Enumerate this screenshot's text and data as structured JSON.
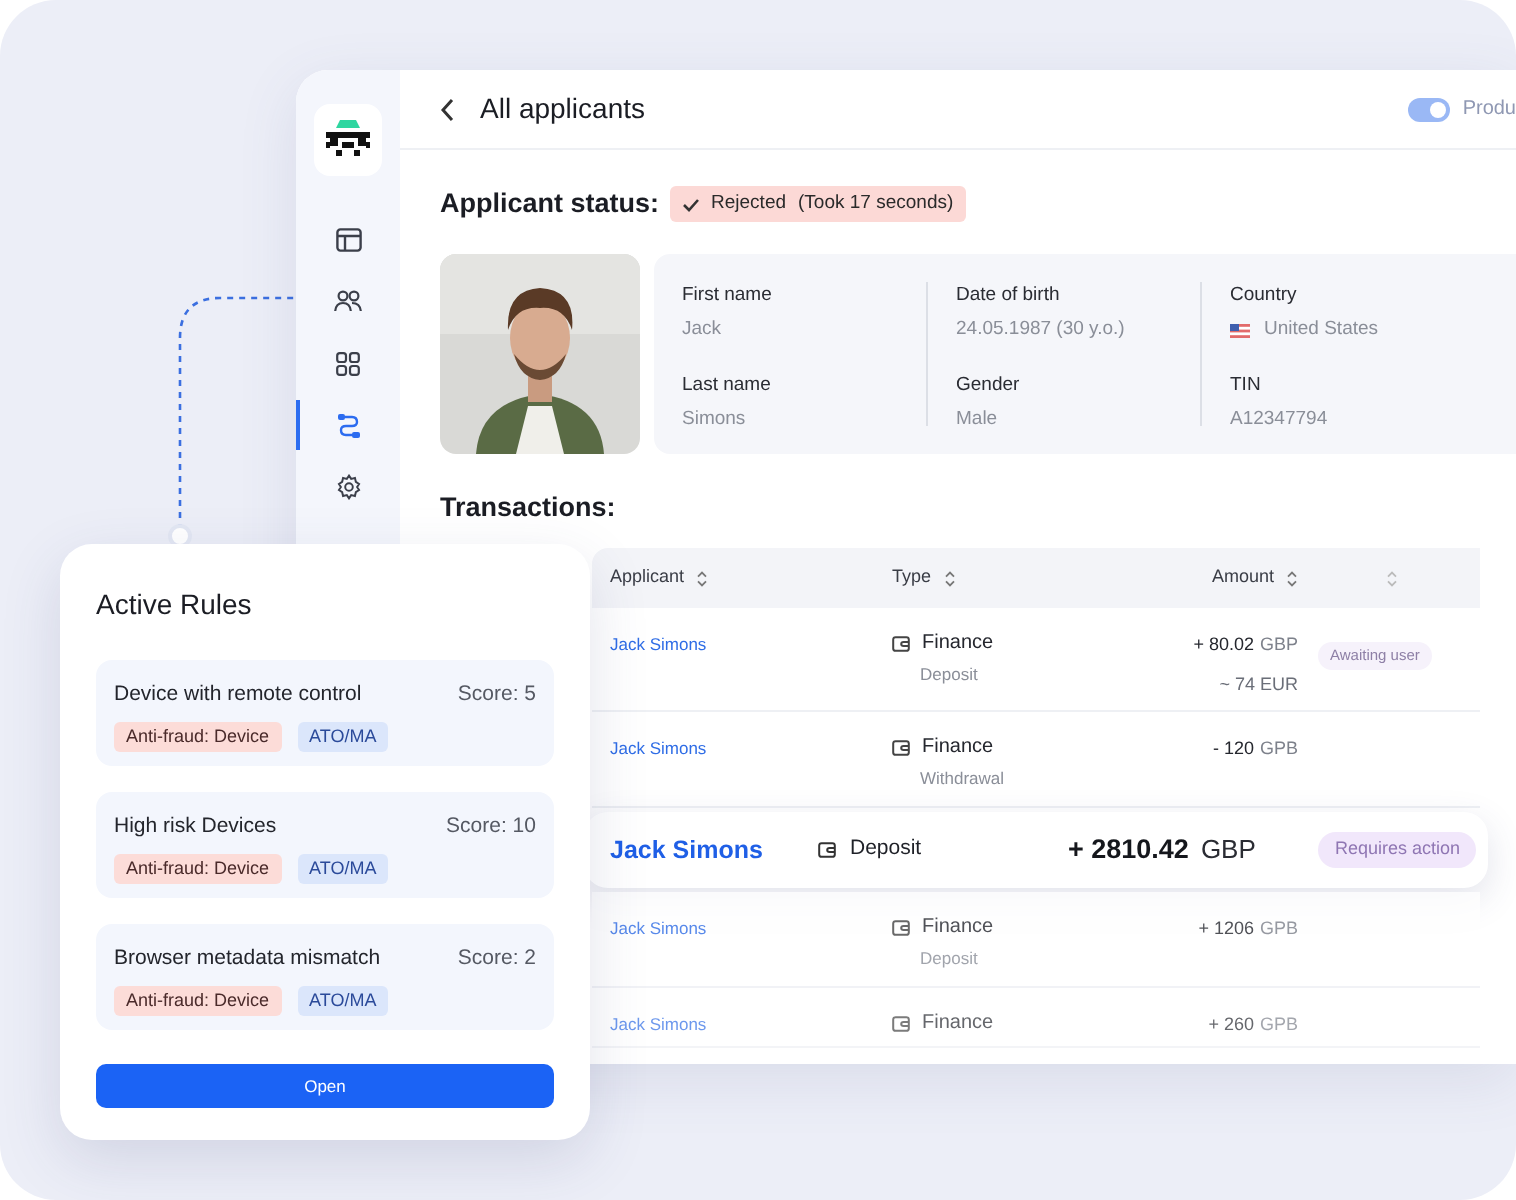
{
  "header": {
    "title": "All applicants",
    "toggle": {
      "on": true
    },
    "toggle_label": "Produ"
  },
  "sidebar": {
    "items": [
      {
        "selected": false
      },
      {
        "selected": false
      },
      {
        "selected": false
      },
      {
        "selected": true
      },
      {
        "selected": false
      }
    ]
  },
  "applicant": {
    "status_label": "Applicant status:",
    "status": "Rejected",
    "duration": "(Took 17 seconds)",
    "columns": [
      [
        {
          "kind": "text",
          "label": "First name",
          "value": "Jack"
        },
        {
          "kind": "text",
          "label": "Last name",
          "value": "Simons"
        }
      ],
      [
        {
          "kind": "text",
          "label": "Date of birth",
          "value": "24.05.1987 (30 y.o.)"
        },
        {
          "kind": "text",
          "label": "Gender",
          "value": "Male"
        }
      ],
      [
        {
          "kind": "country",
          "label": "Country",
          "value": "United States"
        },
        {
          "kind": "text",
          "label": "TIN",
          "value": "A12347794"
        }
      ]
    ]
  },
  "transactions": {
    "title": "Transactions:",
    "columns": [
      "Applicant",
      "Type",
      "Amount"
    ],
    "rows": [
      {
        "kind": "row",
        "applicant": "Jack Simons",
        "type": "Finance",
        "subtype": "Deposit",
        "amount": "+ 80.02",
        "currency": "GBP",
        "converted": "~ 74 EUR",
        "status": "Awaiting user"
      },
      {
        "kind": "row",
        "applicant": "Jack Simons",
        "type": "Finance",
        "subtype": "Withdrawal",
        "amount": "- 120",
        "currency": "GPB"
      },
      {
        "kind": "highlight",
        "name": "Jack Simons",
        "label": "Deposit",
        "sum": "+ 2810.42",
        "unit": "GBP",
        "badge": "Requires action"
      },
      {
        "kind": "row",
        "applicant": "Jack Simons",
        "type": "Finance",
        "subtype": "Deposit",
        "amount": "+ 1206",
        "currency": "GPB"
      },
      {
        "kind": "row",
        "applicant": "Jack Simons",
        "type": "Finance",
        "amount": "+ 260",
        "currency": "GPB"
      }
    ]
  },
  "rules_panel": {
    "title": "Active Rules",
    "button": "Open",
    "rules": [
      {
        "name": "Device with remote control",
        "score": "Score: 5",
        "tags": [
          {
            "label": "Anti-fraud: Device",
            "color": "#fcdcd8"
          },
          {
            "label": "ATO/MA",
            "color": "#dbe6fb"
          }
        ]
      },
      {
        "name": "High risk Devices",
        "score": "Score: 10",
        "tags": [
          {
            "label": "Anti-fraud: Device",
            "color": "#fcdcd8"
          },
          {
            "label": "ATO/MA",
            "color": "#dbe6fb"
          }
        ]
      },
      {
        "name": "Browser metadata mismatch",
        "score": "Score: 2",
        "tags": [
          {
            "label": "Anti-fraud: Device",
            "color": "#fcdcd8"
          },
          {
            "label": "ATO/MA",
            "color": "#dbe6fb"
          }
        ]
      }
    ]
  }
}
